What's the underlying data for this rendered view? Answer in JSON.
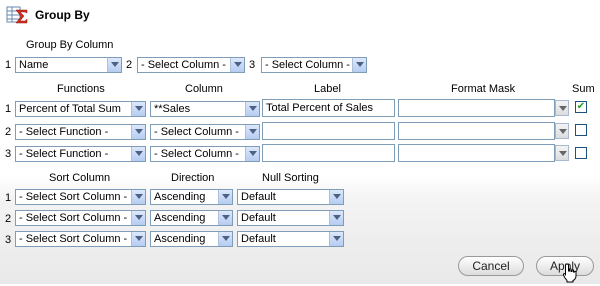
{
  "title": "Group By",
  "group_by": {
    "header": "Group By Column",
    "row_numbers": [
      "1",
      "2",
      "3"
    ],
    "selects": [
      "Name",
      "- Select Column -",
      "- Select Column -"
    ]
  },
  "functions_table": {
    "headers": {
      "functions": "Functions",
      "column": "Column",
      "label": "Label",
      "format_mask": "Format Mask",
      "sum": "Sum"
    },
    "rows": [
      {
        "num": "1",
        "function": "Percent of Total Sum",
        "column": "**Sales",
        "label": "Total Percent of Sales",
        "format_mask": "",
        "sum_checked": true
      },
      {
        "num": "2",
        "function": "- Select Function -",
        "column": "- Select Column -",
        "label": "",
        "format_mask": "",
        "sum_checked": false
      },
      {
        "num": "3",
        "function": "- Select Function -",
        "column": "- Select Column -",
        "label": "",
        "format_mask": "",
        "sum_checked": false
      }
    ]
  },
  "sort_table": {
    "headers": {
      "sort_column": "Sort Column",
      "direction": "Direction",
      "null_sorting": "Null Sorting"
    },
    "rows": [
      {
        "num": "1",
        "sort_column": "- Select Sort Column -",
        "direction": "Ascending",
        "null_sorting": "Default"
      },
      {
        "num": "2",
        "sort_column": "- Select Sort Column -",
        "direction": "Ascending",
        "null_sorting": "Default"
      },
      {
        "num": "3",
        "sort_column": "- Select Sort Column -",
        "direction": "Ascending",
        "null_sorting": "Default"
      }
    ]
  },
  "buttons": {
    "cancel": "Cancel",
    "apply": "Apply"
  },
  "icons": {
    "title_icon": "sigma-sum-icon",
    "cursor": "hand-pointer-icon",
    "check": "✔"
  }
}
